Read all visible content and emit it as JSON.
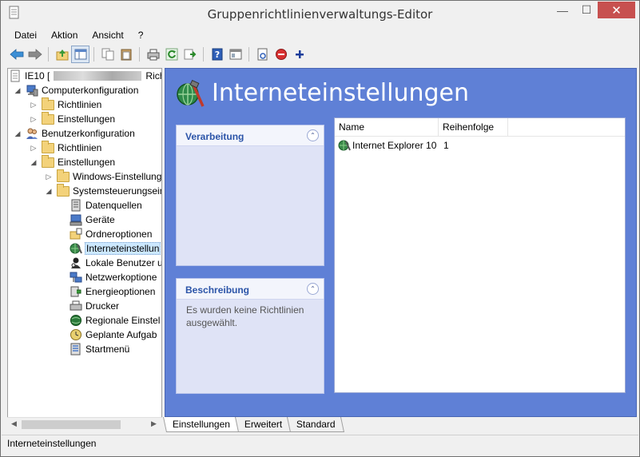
{
  "window": {
    "title": "Gruppenrichtlinienverwaltungs-Editor",
    "controls": {
      "minimize": "—",
      "maximize": "☐",
      "close": "✕"
    }
  },
  "menu": [
    {
      "label": "Datei",
      "accel": "D"
    },
    {
      "label": "Aktion",
      "accel": "k"
    },
    {
      "label": "Ansicht",
      "accel": "A"
    },
    {
      "label": "?",
      "accel": "?"
    }
  ],
  "toolbar": {
    "buttons": [
      "back-icon",
      "forward-icon",
      "up-folder-icon",
      "show-hide-tree-icon",
      "copy-icon",
      "paste-icon",
      "print-icon",
      "refresh-icon",
      "export-icon",
      "help-icon",
      "view-icon",
      "properties-icon",
      "delete-icon",
      "add-icon"
    ]
  },
  "tree": {
    "root": "IE10 [",
    "root_suffix": "Rich",
    "items": [
      {
        "label": "Computerkonfiguration"
      },
      {
        "label": "Richtlinien"
      },
      {
        "label": "Einstellungen"
      },
      {
        "label": "Benutzerkonfiguration"
      },
      {
        "label": "Richtlinien"
      },
      {
        "label": "Einstellungen"
      },
      {
        "label": "Windows-Einstellung"
      },
      {
        "label": "Systemsteuerungsein"
      },
      {
        "label": "Datenquellen"
      },
      {
        "label": "Geräte"
      },
      {
        "label": "Ordneroptionen"
      },
      {
        "label": "Interneteinstellun"
      },
      {
        "label": "Lokale Benutzer u"
      },
      {
        "label": "Netzwerkoptione"
      },
      {
        "label": "Energieoptionen"
      },
      {
        "label": "Drucker"
      },
      {
        "label": "Regionale Einstel"
      },
      {
        "label": "Geplante Aufgab"
      },
      {
        "label": "Startmenü"
      }
    ]
  },
  "main": {
    "title": "Interneteinstellungen",
    "processing_panel": {
      "title": "Verarbeitung"
    },
    "description_panel": {
      "title": "Beschreibung",
      "text": "Es wurden keine Richtlinien ausgewählt."
    },
    "list": {
      "columns": [
        "Name",
        "Reihenfolge"
      ],
      "rows": [
        {
          "name": "Internet Explorer 10",
          "order": "1"
        }
      ]
    }
  },
  "tabs": [
    "Einstellungen",
    "Erweitert",
    "Standard"
  ],
  "status": {
    "text": "Interneteinstellungen"
  },
  "colors": {
    "right_pane": "#5f80d6",
    "panel_title": "#2b54a8",
    "close_button": "#c7504f",
    "selection": "#cce8ff"
  }
}
